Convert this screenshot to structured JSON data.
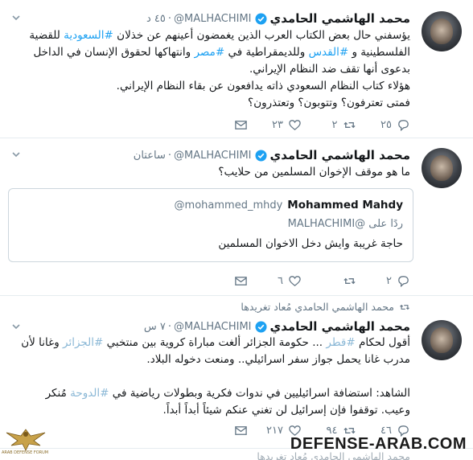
{
  "tweets": [
    {
      "name": "محمد الهاشمي الحامدي",
      "handle": "@MALHACHIMI",
      "time": "٤٥ د",
      "lines": [
        [
          "يؤسفني حال بعض الكتاب العرب الذين يغمضون أعينهم عن خذلان ",
          "#السعودية",
          " للقضية"
        ],
        [
          "الفلسطينية و ",
          "#القدس",
          " وللديمقراطية في ",
          "#مصر",
          " وانتهاكها لحقوق الإنسان في الداخل"
        ],
        [
          "بدعوى أنها تقف ضد النظام الإيراني."
        ],
        [
          "هؤلاء كتاب النظام السعودي ذاته يدافعون عن بقاء النظام الإيراني."
        ],
        [
          "فمتى تعترفون؟ وتتوبون؟ وتعتذرون؟"
        ]
      ],
      "replies": "٢٥",
      "retweets": "٢",
      "likes": "٢٣",
      "dm": ""
    },
    {
      "name": "محمد الهاشمي الحامدي",
      "handle": "@MALHACHIMI",
      "time": "ساعتان",
      "text": "ما هو موقف الإخوان المسلمين من حلايب؟",
      "quote": {
        "name": "Mohammed Mahdy",
        "handle": "@mohammed_mhdy",
        "reply_to": "ردًا على @MALHACHIMI",
        "text": "حاجة غريبة وايش دخل الاخوان المسلمين"
      },
      "replies": "٢",
      "retweets": "",
      "likes": "٦",
      "dm": ""
    },
    {
      "retweet_context": "محمد الهاشمي الحامدي مُعاد تغريدها",
      "name": "محمد الهاشمي الحامدي",
      "handle": "@MALHACHIMI",
      "time": "٧ س",
      "lines": [
        [
          "أقول لحكام ",
          "#قطر",
          " ... حكومة الجزائر ألغت مباراة كروية بين منتخبي ",
          "#الجزائر",
          " وغانا لأن"
        ],
        [
          "مدرب غانا يحمل جواز سفر اسرائيلي.. ومنعت دخوله البلاد."
        ],
        [
          ""
        ],
        [
          "الشاهد: استضافة اسرائيليين في ندوات فكرية وبطولات رياضية في ",
          "#الدوحة",
          " مُنكر"
        ],
        [
          "وعيب. توقفوا فإن إسرائيل لن تغني عنكم شيئاً أبداً أبداً."
        ]
      ],
      "replies": "٤٦",
      "retweets": "٩٤",
      "likes": "٢١٧",
      "dm": ""
    },
    {
      "retweet_context": "محمد الهاشمي الحامدي مُعاد تغريدها"
    }
  ],
  "watermark": "DEFENSE-ARAB.COM",
  "logo_text": "ARAB DEFENSE FORUM",
  "colors": {
    "link": "#1da1f2",
    "muted": "#657786",
    "verified": "#1da1f2",
    "border": "#e6ecf0"
  },
  "icons": [
    "verified-icon",
    "chevron-down-icon",
    "reply-icon",
    "retweet-icon",
    "like-icon",
    "dm-icon"
  ]
}
